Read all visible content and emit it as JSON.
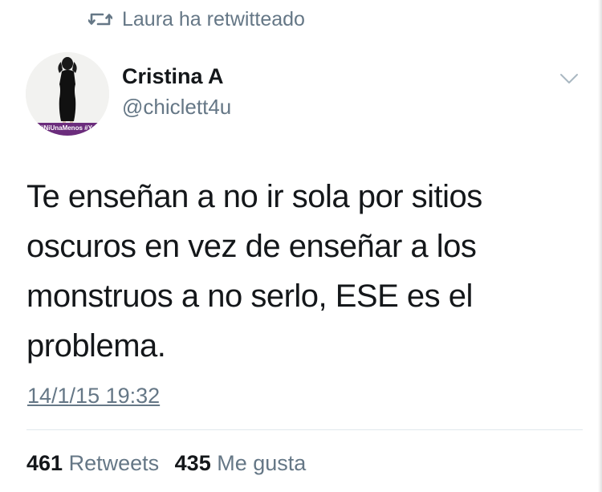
{
  "retweet_context": {
    "icon": "retweet-icon",
    "text": "Laura ha retwitteado"
  },
  "author": {
    "display_name": "Cristina A",
    "handle": "@chiclett4u",
    "avatar_band_text": "#NiUnaMenos #YoVoy"
  },
  "menu": {
    "icon": "chevron-down-icon"
  },
  "tweet": {
    "lines": [
      "Te enseñan a no ir sola por sitios",
      "oscuros en vez de enseñar a los",
      "monstruos a no serlo, ESE es el",
      "problema."
    ],
    "timestamp": "14/1/15 19:32"
  },
  "stats": {
    "retweets_count": "461",
    "retweets_label": "Retweets",
    "likes_count": "435",
    "likes_label": "Me gusta"
  },
  "colors": {
    "text_primary": "#14171a",
    "text_secondary": "#657786",
    "divider": "#e1e8ed",
    "avatar_band": "#6b2c7c"
  }
}
